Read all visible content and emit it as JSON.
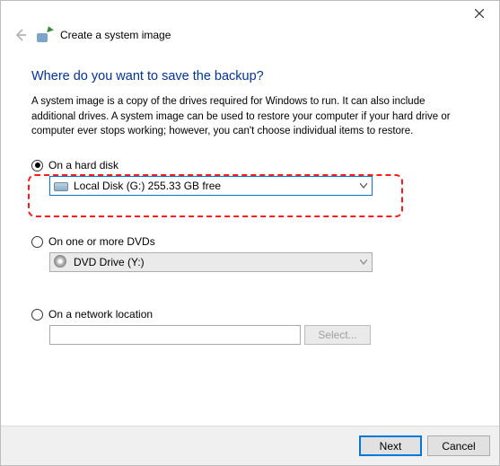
{
  "window": {
    "title": "Create a system image"
  },
  "heading": "Where do you want to save the backup?",
  "description": "A system image is a copy of the drives required for Windows to run. It can also include additional drives. A system image can be used to restore your computer if your hard drive or computer ever stops working; however, you can't choose individual items to restore.",
  "options": {
    "hard_disk": {
      "label": "On a hard disk",
      "selected": "Local Disk (G:)  255.33 GB free"
    },
    "dvds": {
      "label": "On one or more DVDs",
      "selected": "DVD Drive (Y:)"
    },
    "network": {
      "label": "On a network location",
      "select_button": "Select..."
    }
  },
  "footer": {
    "next": "Next",
    "cancel": "Cancel"
  }
}
